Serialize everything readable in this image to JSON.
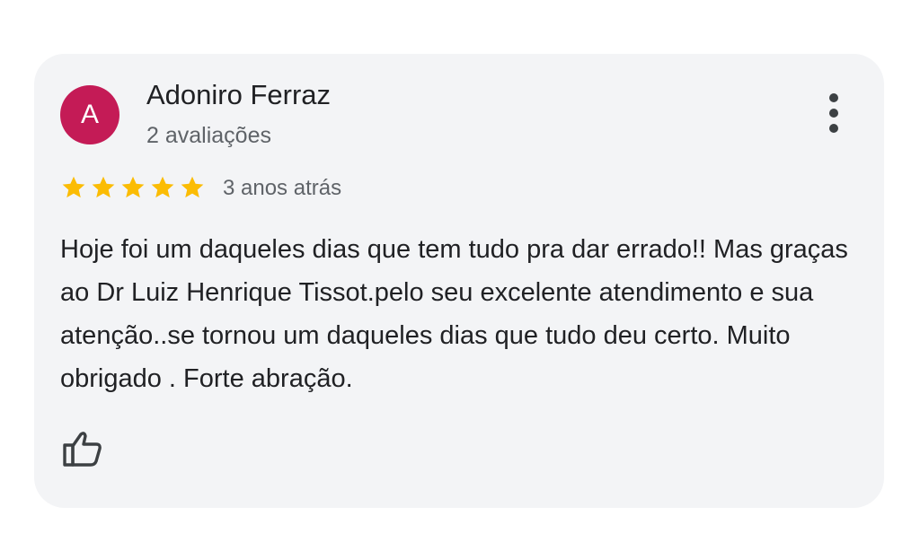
{
  "review": {
    "avatar_letter": "A",
    "author": "Adoniro Ferraz",
    "reviews_count": "2 avaliações",
    "rating": 5,
    "rating_max": 5,
    "time_ago": "3 anos atrás",
    "text": "Hoje foi um daqueles dias que tem tudo pra dar errado!! Mas graças ao Dr Luiz Henrique Tissot.pelo seu excelente atendimento e sua atenção..se tornou um daqueles dias que tudo deu certo. Muito obrigado . Forte abração."
  },
  "icons": {
    "more": "more-vert-icon",
    "star": "star-icon",
    "like": "thumbs-up-icon"
  },
  "colors": {
    "avatar_bg": "#c41b56",
    "star": "#fbbc04",
    "card_bg": "#f3f4f6"
  }
}
